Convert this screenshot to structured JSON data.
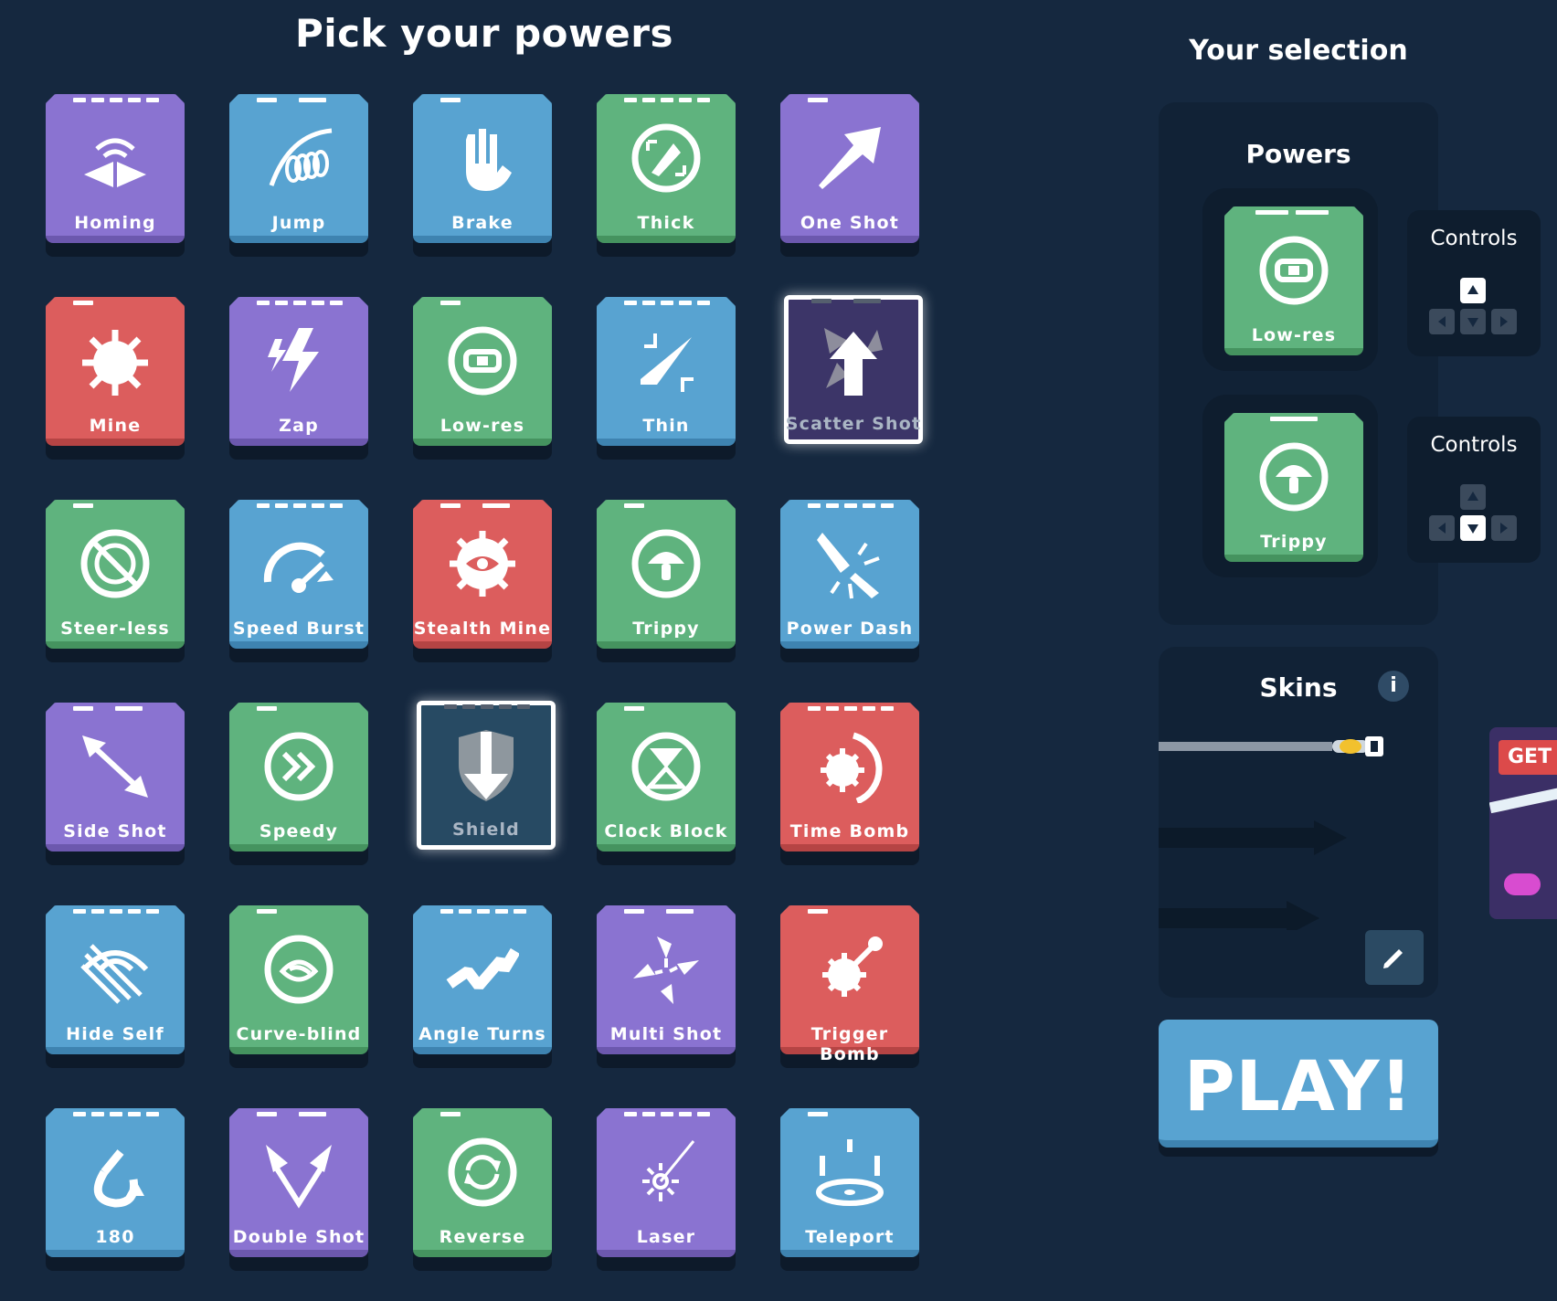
{
  "header": {
    "title": "Pick your powers"
  },
  "powers": [
    {
      "label": "Homing",
      "color": "purple",
      "icon": "homing-icon"
    },
    {
      "label": "Jump",
      "color": "blue",
      "icon": "jump-icon"
    },
    {
      "label": "Brake",
      "color": "blue",
      "icon": "brake-hand-icon"
    },
    {
      "label": "Thick",
      "color": "green",
      "icon": "thick-icon"
    },
    {
      "label": "One Shot",
      "color": "purple",
      "icon": "one-shot-arrow-icon"
    },
    {
      "label": "Mine",
      "color": "red",
      "icon": "mine-icon"
    },
    {
      "label": "Zap",
      "color": "purple",
      "icon": "zap-icon"
    },
    {
      "label": "Low-res",
      "color": "green",
      "icon": "low-res-icon"
    },
    {
      "label": "Thin",
      "color": "blue",
      "icon": "thin-icon"
    },
    {
      "label": "Scatter Shot",
      "color": "purple",
      "icon": "scatter-shot-icon",
      "selected": true
    },
    {
      "label": "Steer-less",
      "color": "green",
      "icon": "steer-less-icon"
    },
    {
      "label": "Speed Burst",
      "color": "blue",
      "icon": "speedometer-icon"
    },
    {
      "label": "Stealth Mine",
      "color": "red",
      "icon": "stealth-mine-icon"
    },
    {
      "label": "Trippy",
      "color": "green",
      "icon": "mushroom-icon"
    },
    {
      "label": "Power Dash",
      "color": "blue",
      "icon": "power-dash-icon"
    },
    {
      "label": "Side Shot",
      "color": "purple",
      "icon": "side-shot-icon"
    },
    {
      "label": "Speedy",
      "color": "green",
      "icon": "fast-forward-icon"
    },
    {
      "label": "Shield",
      "color": "blue",
      "icon": "shield-icon",
      "selected": true
    },
    {
      "label": "Clock Block",
      "color": "green",
      "icon": "hourglass-icon"
    },
    {
      "label": "Time Bomb",
      "color": "red",
      "icon": "time-bomb-icon"
    },
    {
      "label": "Hide Self",
      "color": "blue",
      "icon": "eye-hidden-icon"
    },
    {
      "label": "Curve-blind",
      "color": "green",
      "icon": "curve-blind-icon"
    },
    {
      "label": "Angle Turns",
      "color": "blue",
      "icon": "zigzag-icon"
    },
    {
      "label": "Multi Shot",
      "color": "purple",
      "icon": "multi-shot-icon"
    },
    {
      "label": "Trigger Bomb",
      "color": "red",
      "icon": "trigger-bomb-icon"
    },
    {
      "label": "180",
      "color": "blue",
      "icon": "u-turn-icon"
    },
    {
      "label": "Double Shot",
      "color": "purple",
      "icon": "double-shot-icon"
    },
    {
      "label": "Reverse",
      "color": "green",
      "icon": "reverse-icon"
    },
    {
      "label": "Laser",
      "color": "purple",
      "icon": "laser-icon"
    },
    {
      "label": "Teleport",
      "color": "blue",
      "icon": "teleport-icon"
    }
  ],
  "selection": {
    "title": "Your selection",
    "powers_title": "Powers",
    "slots": [
      {
        "label": "Low-res",
        "icon": "low-res-icon",
        "controls_title": "Controls",
        "active_key": "up"
      },
      {
        "label": "Trippy",
        "icon": "mushroom-icon",
        "controls_title": "Controls",
        "active_key": "down"
      }
    ],
    "skins_title": "Skins",
    "info_label": "i",
    "promo_label": "GET"
  },
  "play": {
    "label": "PLAY!"
  },
  "colors": {
    "background": "#15283f",
    "purple": "#8a73d1",
    "blue": "#58a3d1",
    "green": "#5fb37e",
    "red": "#dc5d5d"
  }
}
